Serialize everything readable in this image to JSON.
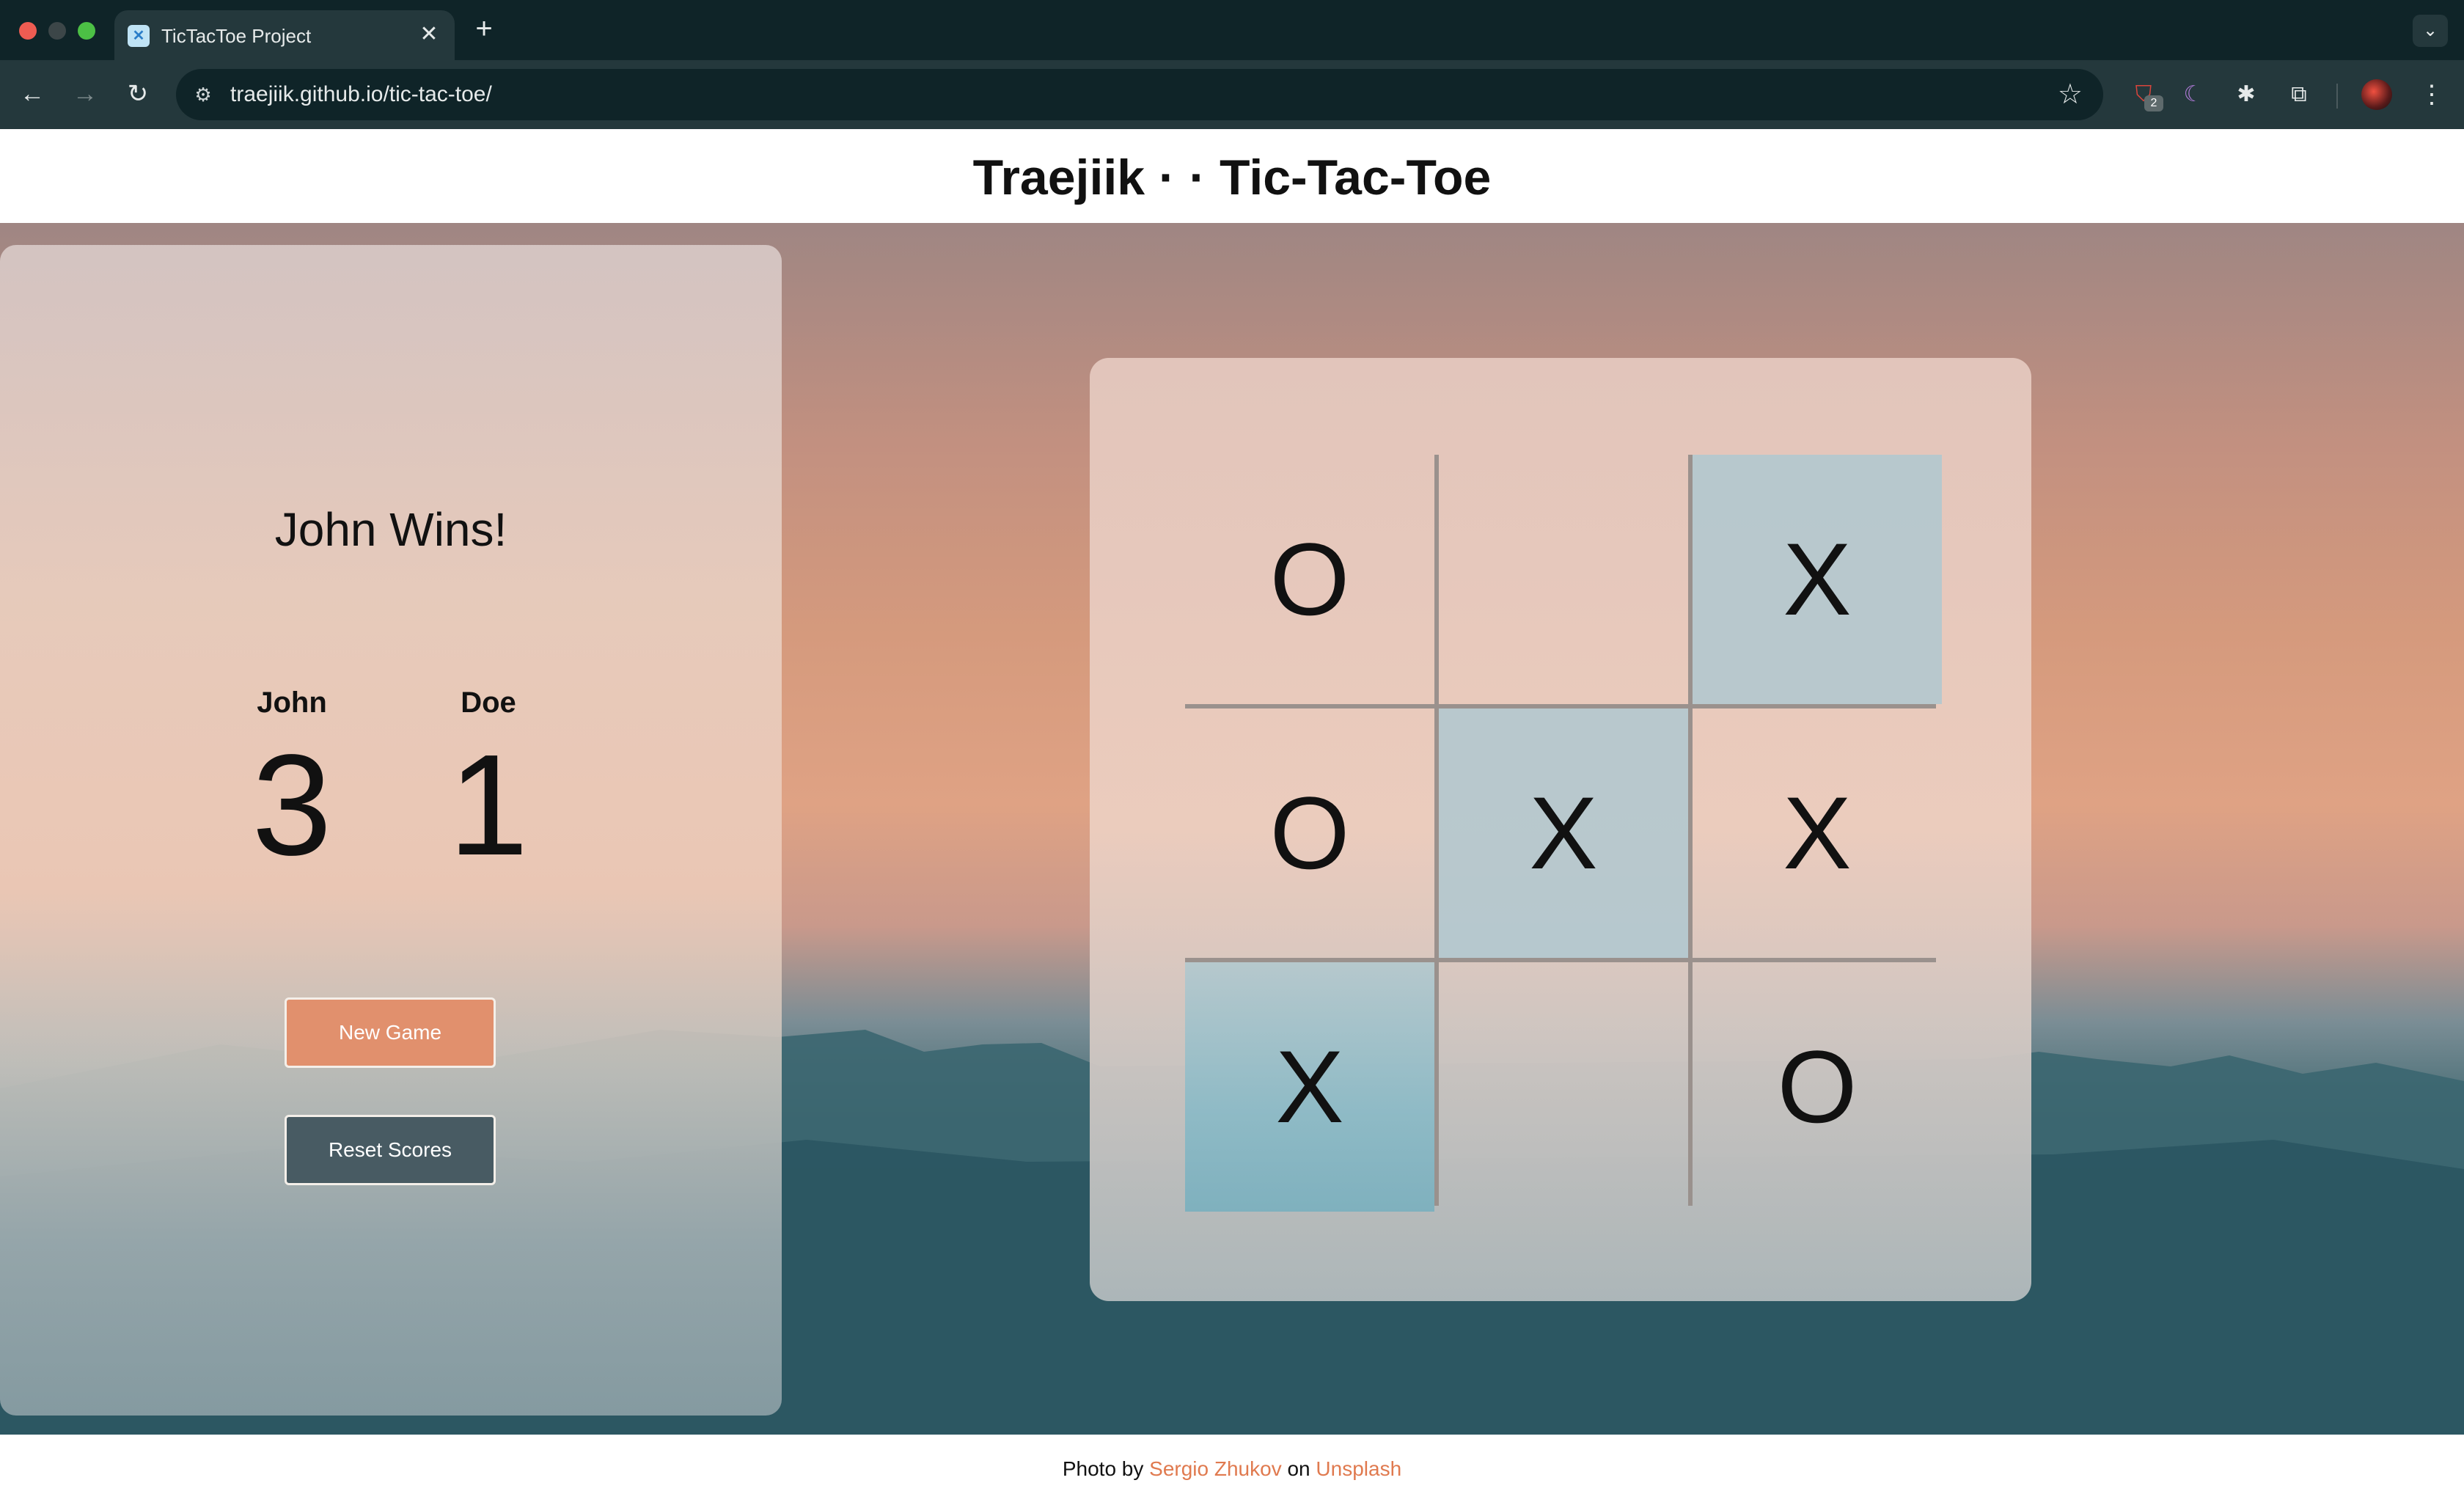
{
  "browser": {
    "tab_title": "TicTacToe Project",
    "tab_close": "✕",
    "new_tab": "+",
    "tab_menu": "⌄",
    "url": "traejiik.github.io/tic-tac-toe/",
    "extension_badge": "2",
    "icons": [
      "back-arrow-icon",
      "forward-arrow-icon",
      "reload-icon",
      "site-info-icon",
      "bookmark-star-icon",
      "shield-extension-icon",
      "moon-extension-icon",
      "bug-extension-icon",
      "puzzle-extensions-icon",
      "profile-avatar",
      "more-menu-icon"
    ]
  },
  "header": {
    "title": "Traejiik · · Tic-Tac-Toe"
  },
  "game": {
    "status": "John Wins!",
    "players": [
      {
        "name": "John",
        "score": "3"
      },
      {
        "name": "Doe",
        "score": "1"
      }
    ],
    "new_game_label": "New Game",
    "reset_scores_label": "Reset Scores",
    "board": [
      "O",
      "",
      "X",
      "O",
      "X",
      "X",
      "X",
      "",
      "O"
    ],
    "winning_cells": [
      2,
      4,
      6
    ],
    "accent_color": "#e1906d",
    "reset_color": "#485b63"
  },
  "footer": {
    "prefix": "Photo by",
    "photographer": "Sergio Zhukov",
    "middle": "on",
    "source": "Unsplash"
  }
}
